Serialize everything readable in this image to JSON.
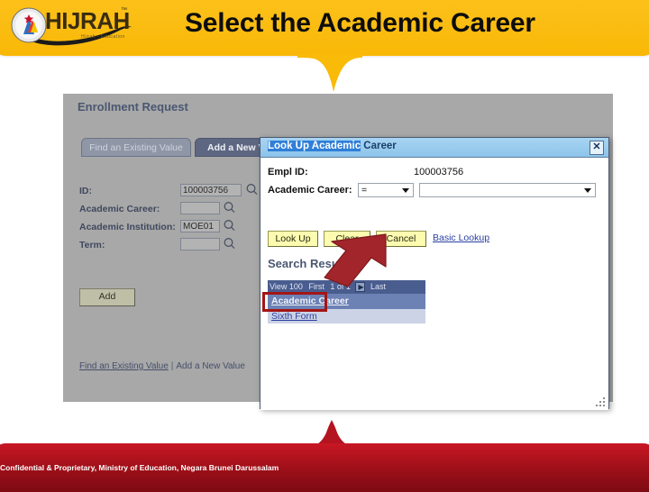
{
  "header": {
    "title": "Select the Academic Career",
    "logo_text": "HIJRAH",
    "logo_tm": "™",
    "logo_sub": "Hijrah - Education"
  },
  "app": {
    "title": "Enrollment Request",
    "tabs": [
      {
        "label": "Find an Existing Value",
        "active": false
      },
      {
        "label": "Add a New Value",
        "active": true
      }
    ],
    "form": [
      {
        "label": "ID:",
        "value": "100003756"
      },
      {
        "label": "Academic Career:",
        "value": ""
      },
      {
        "label": "Academic Institution:",
        "value": "MOE01"
      },
      {
        "label": "Term:",
        "value": ""
      }
    ],
    "add_button": "Add",
    "bottom_links": {
      "find_existing": "Find an Existing Value",
      "separator": "|",
      "add_new": "Add a New Value"
    }
  },
  "modal": {
    "title_highlighted": "Look Up Academic",
    "title_rest": " Career",
    "close_label": "✕",
    "empl_id_label": "Empl ID:",
    "empl_id_value": "100003756",
    "academic_career_label": "Academic Career:",
    "operator_value": "=",
    "career_value": "",
    "buttons": [
      {
        "label": "Look Up"
      },
      {
        "label": "Clear"
      },
      {
        "label": "Cancel"
      }
    ],
    "basic_lookup_link": "Basic Lookup",
    "search_results_title": "Search Results",
    "result_nav": {
      "view": "View 100",
      "first": "First",
      "range": "1 of 1",
      "next_icon": "▶",
      "last": "Last"
    },
    "result_column": "Academic Career",
    "result_rows": [
      {
        "value": "Sixth Form"
      }
    ]
  },
  "footer": {
    "text": "Confidential & Proprietary, Ministry of Education, Negara Brunei Darussalam"
  },
  "colors": {
    "header_yellow": "#fbbe15",
    "footer_red": "#9c0f18",
    "accent_blue": "#2f7fd8",
    "link_blue": "#2a3fa0",
    "highlight_red": "#a41515",
    "arrow_red": "#a1252a"
  }
}
